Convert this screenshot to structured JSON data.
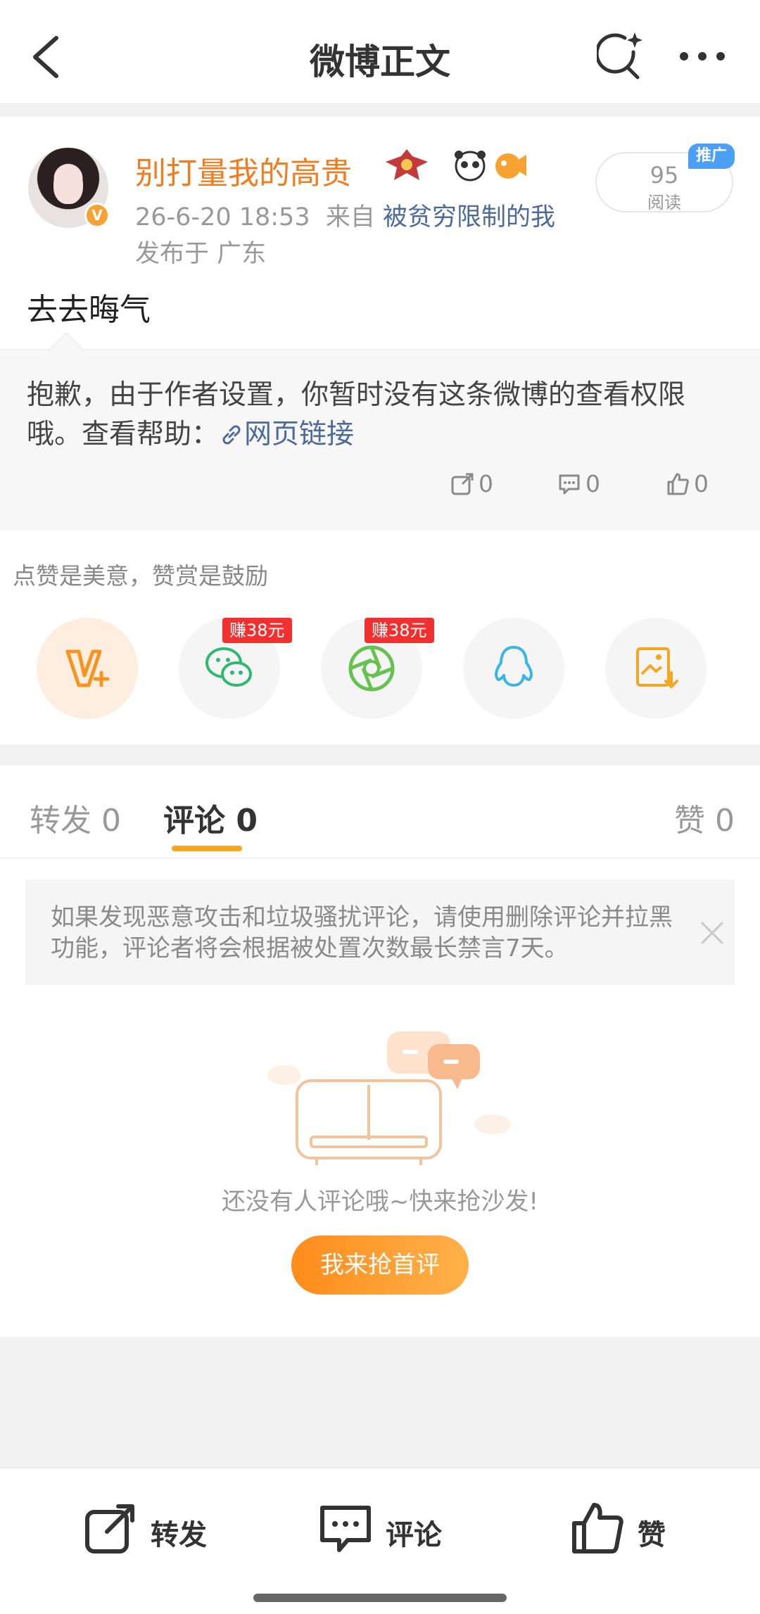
{
  "header": {
    "title": "微博正文"
  },
  "post": {
    "username": "别打量我的高贵",
    "date": "26-6-20 18:53",
    "source_prefix": "来自",
    "source": "被贫穷限制的我",
    "location": "发布于 广东",
    "reads_count": "95",
    "reads_label": "阅读",
    "promo_label": "推广",
    "text": "去去晦气",
    "verified_icon": "v-badge-icon"
  },
  "notice": {
    "text": "抱歉，由于作者设置，你暂时没有这条微博的查看权限哦。查看帮助：",
    "link_label": "网页链接",
    "repost_count": "0",
    "comment_count": "0",
    "like_count": "0"
  },
  "reward": {
    "title": "点赞是美意，赞赏是鼓励",
    "earn_wechat": "赚38元",
    "earn_moments": "赚38元"
  },
  "tabs": {
    "repost_label": "转发",
    "repost_count": "0",
    "comment_label": "评论",
    "comment_count": "0",
    "like_label": "赞",
    "like_count": "0"
  },
  "comments": {
    "tip": "如果发现恶意攻击和垃圾骚扰评论，请使用删除评论并拉黑功能，评论者将会根据被处置次数最长禁言7天。",
    "empty_text": "还没有人评论哦~快来抢沙发!",
    "first_comment_button": "我来抢首评"
  },
  "bottom_bar": {
    "repost": "转发",
    "comment": "评论",
    "like": "赞"
  },
  "colors": {
    "accent_orange": "#f07d1f",
    "link_blue": "#4c6b9a",
    "promo_blue": "#4b9ff5",
    "earn_red": "#f23030"
  }
}
